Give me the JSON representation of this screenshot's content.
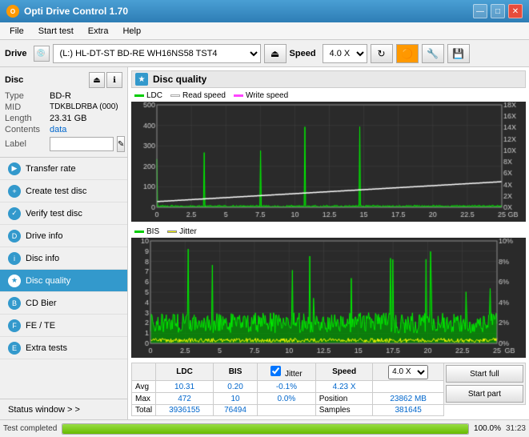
{
  "titleBar": {
    "appName": "Opti Drive Control 1.70",
    "controls": [
      "—",
      "□",
      "✕"
    ]
  },
  "menuBar": {
    "items": [
      "File",
      "Start test",
      "Extra",
      "Help"
    ]
  },
  "toolbar": {
    "driveLabel": "Drive",
    "driveValue": "(L:)  HL-DT-ST BD-RE  WH16NS58 TST4",
    "speedLabel": "Speed",
    "speedValue": "4.0 X"
  },
  "disc": {
    "sectionTitle": "Disc",
    "type": {
      "label": "Type",
      "value": "BD-R"
    },
    "mid": {
      "label": "MID",
      "value": "TDKBLDRBA (000)"
    },
    "length": {
      "label": "Length",
      "value": "23.31 GB"
    },
    "contents": {
      "label": "Contents",
      "value": "data"
    },
    "label": {
      "label": "Label",
      "value": ""
    }
  },
  "navItems": [
    {
      "id": "transfer-rate",
      "label": "Transfer rate"
    },
    {
      "id": "create-test-disc",
      "label": "Create test disc"
    },
    {
      "id": "verify-test-disc",
      "label": "Verify test disc"
    },
    {
      "id": "drive-info",
      "label": "Drive info"
    },
    {
      "id": "disc-info",
      "label": "Disc info"
    },
    {
      "id": "disc-quality",
      "label": "Disc quality",
      "active": true
    },
    {
      "id": "cd-bier",
      "label": "CD Bier"
    },
    {
      "id": "fe-te",
      "label": "FE / TE"
    },
    {
      "id": "extra-tests",
      "label": "Extra tests"
    }
  ],
  "statusWindow": {
    "label": "Status window > >"
  },
  "chartPanel": {
    "title": "Disc quality",
    "topChart": {
      "legend": [
        {
          "label": "LDC",
          "color": "#00cc00"
        },
        {
          "label": "Read speed",
          "color": "#ffffff"
        },
        {
          "label": "Write speed",
          "color": "#ff44ff"
        }
      ],
      "yMax": 500,
      "yMin": 0,
      "rightYMax": 18,
      "xMax": 25
    },
    "bottomChart": {
      "legend": [
        {
          "label": "BIS",
          "color": "#00cc00"
        },
        {
          "label": "Jitter",
          "color": "#ffff00"
        }
      ],
      "yMax": 10,
      "yMin": 0,
      "rightYMax": 10,
      "xMax": 25
    }
  },
  "stats": {
    "columns": [
      "LDC",
      "BIS",
      "",
      "Jitter",
      "Speed",
      ""
    ],
    "rows": {
      "avg": {
        "label": "Avg",
        "ldc": "10.31",
        "bis": "0.20",
        "jitter": "-0.1%",
        "speed": "4.23 X",
        "speedTarget": "4.0 X"
      },
      "max": {
        "label": "Max",
        "ldc": "472",
        "bis": "10",
        "jitter": "0.0%",
        "position": "23862 MB"
      },
      "total": {
        "label": "Total",
        "ldc": "3936155",
        "bis": "76494",
        "samples": "381645"
      }
    }
  },
  "controls": {
    "jitterChecked": true,
    "jitterLabel": "Jitter",
    "startFullLabel": "Start full",
    "startPartLabel": "Start part"
  },
  "bottomStatus": {
    "statusText": "Test completed",
    "progressPercent": 100,
    "progressLabel": "100.0%",
    "time": "31:23"
  }
}
